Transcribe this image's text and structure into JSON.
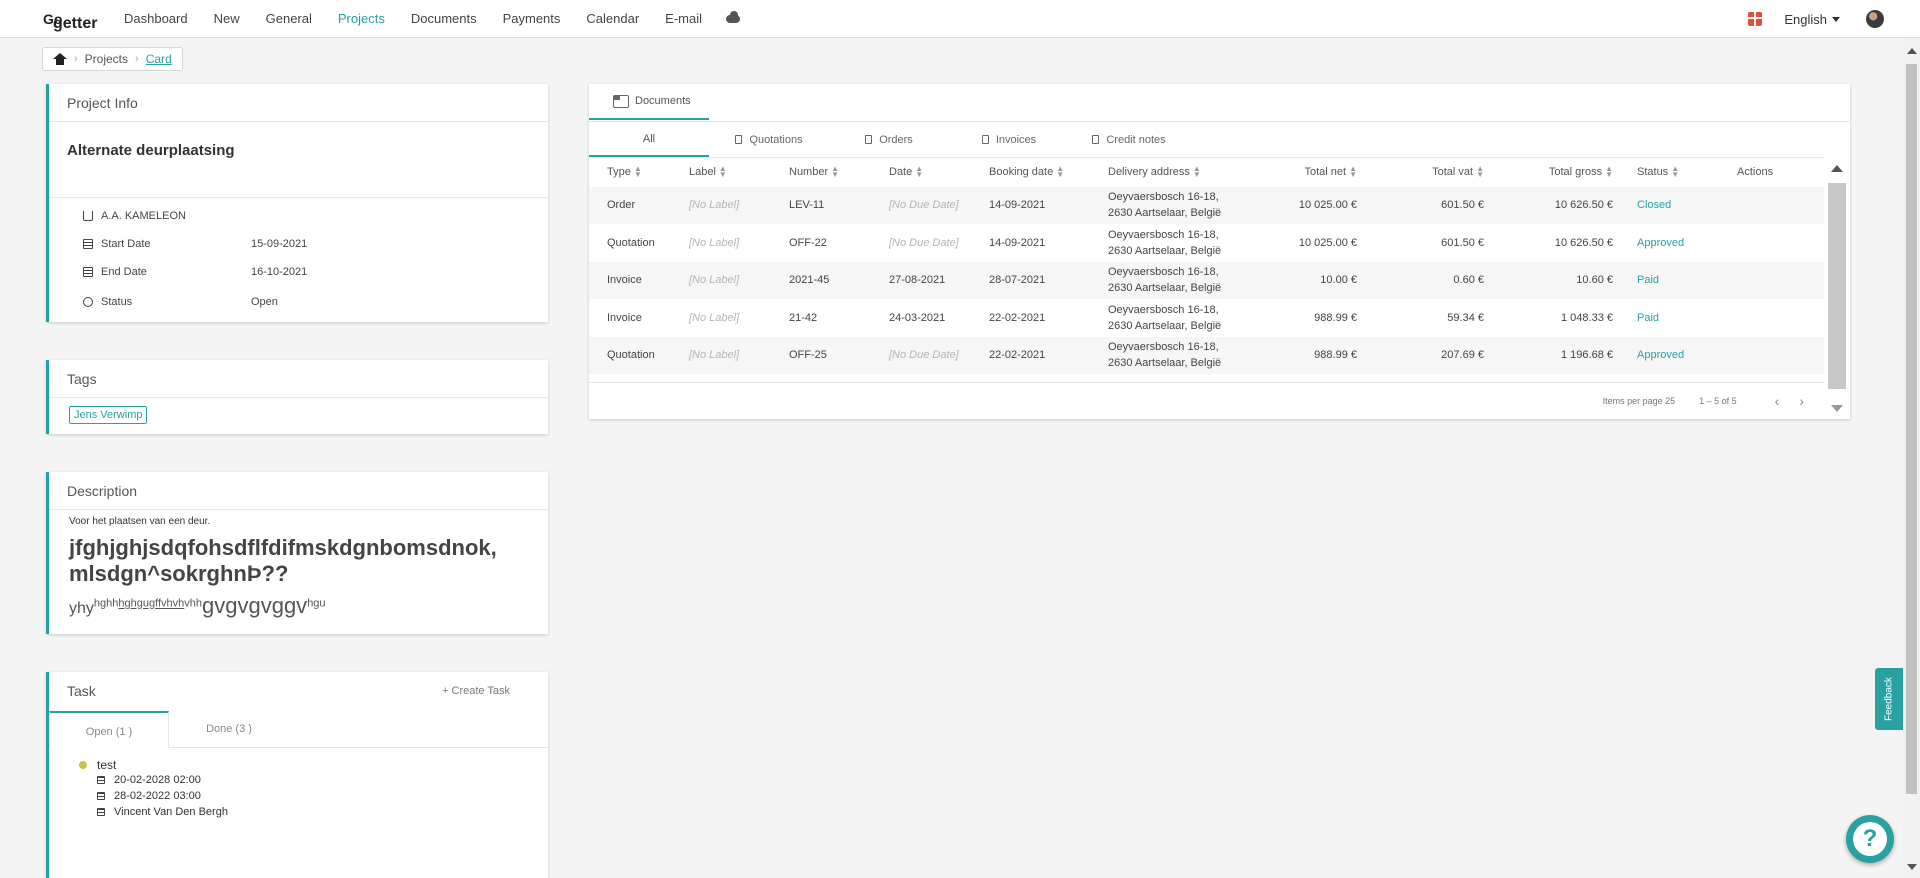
{
  "nav": {
    "logo_top": "Go",
    "logo_bottom": "getter",
    "items": [
      {
        "label": "Dashboard",
        "active": false
      },
      {
        "label": "New",
        "active": false
      },
      {
        "label": "General",
        "active": false
      },
      {
        "label": "Projects",
        "active": true
      },
      {
        "label": "Documents",
        "active": false
      },
      {
        "label": "Payments",
        "active": false
      },
      {
        "label": "Calendar",
        "active": false
      },
      {
        "label": "E-mail",
        "active": false
      }
    ],
    "language": "English"
  },
  "breadcrumb": {
    "items": [
      "Projects",
      "Card"
    ]
  },
  "project_info": {
    "title": "Project Info",
    "name": "Alternate deurplaatsing",
    "client": "A.A. KAMELEON",
    "start_label": "Start Date",
    "start_value": "15-09-2021",
    "end_label": "End Date",
    "end_value": "16-10-2021",
    "status_label": "Status",
    "status_value": "Open"
  },
  "tags": {
    "title": "Tags",
    "items": [
      "Jens Verwimp"
    ]
  },
  "description": {
    "title": "Description",
    "line1": "Voor het plaatsen van een deur.",
    "line2": "jfghjghjsdqfohsdflfdifmskdgnbomsdnok, mlsdgn^sokrghnÞ??",
    "line3_a": "yhy",
    "line3_b": "hghh",
    "line3_c": "hghgugffvhvh",
    "line3_d": "vhh",
    "line3_e": "gvgvgvggv",
    "line3_f": "hgu"
  },
  "task": {
    "title": "Task",
    "create_label": "Create Task",
    "tab_open": "Open (1 )",
    "tab_done": "Done (3 )",
    "item_title": "test",
    "date1": "20-02-2028 02:00",
    "date2": "28-02-2022 03:00",
    "assignee": "Vincent Van Den Bergh"
  },
  "documents": {
    "tab_label": "Documents",
    "subtabs": [
      "All",
      "Quotations",
      "Orders",
      "Invoices",
      "Credit notes"
    ],
    "columns": [
      "Type",
      "Label",
      "Number",
      "Date",
      "Booking date",
      "Delivery address",
      "Total net",
      "Total vat",
      "Total gross",
      "Status",
      "Actions"
    ],
    "rows": [
      {
        "type": "Order",
        "label": "[No Label]",
        "number": "LEV-11",
        "date": "[No Due Date]",
        "booking": "14-09-2021",
        "address": "Oeyvaersbosch 16-18, 2630 Aartselaar, België",
        "net": "10 025.00 €",
        "vat": "601.50 €",
        "gross": "10 626.50 €",
        "status": "Closed"
      },
      {
        "type": "Quotation",
        "label": "[No Label]",
        "number": "OFF-22",
        "date": "[No Due Date]",
        "booking": "14-09-2021",
        "address": "Oeyvaersbosch 16-18, 2630 Aartselaar, België",
        "net": "10 025.00 €",
        "vat": "601.50 €",
        "gross": "10 626.50 €",
        "status": "Approved"
      },
      {
        "type": "Invoice",
        "label": "[No Label]",
        "number": "2021-45",
        "date": "27-08-2021",
        "booking": "28-07-2021",
        "address": "Oeyvaersbosch 16-18, 2630 Aartselaar, België",
        "net": "10.00 €",
        "vat": "0.60 €",
        "gross": "10.60 €",
        "status": "Paid"
      },
      {
        "type": "Invoice",
        "label": "[No Label]",
        "number": "21-42",
        "date": "24-03-2021",
        "booking": "22-02-2021",
        "address": "Oeyvaersbosch 16-18, 2630 Aartselaar, België",
        "net": "988.99 €",
        "vat": "59.34 €",
        "gross": "1 048.33 €",
        "status": "Paid"
      },
      {
        "type": "Quotation",
        "label": "[No Label]",
        "number": "OFF-25",
        "date": "[No Due Date]",
        "booking": "22-02-2021",
        "address": "Oeyvaersbosch 16-18, 2630 Aartselaar, België",
        "net": "988.99 €",
        "vat": "207.69 €",
        "gross": "1 196.68 €",
        "status": "Approved"
      }
    ],
    "items_per_page": "Items per page 25",
    "range": "1 – 5 of 5"
  },
  "feedback_label": "Feedback",
  "help_label": "?"
}
